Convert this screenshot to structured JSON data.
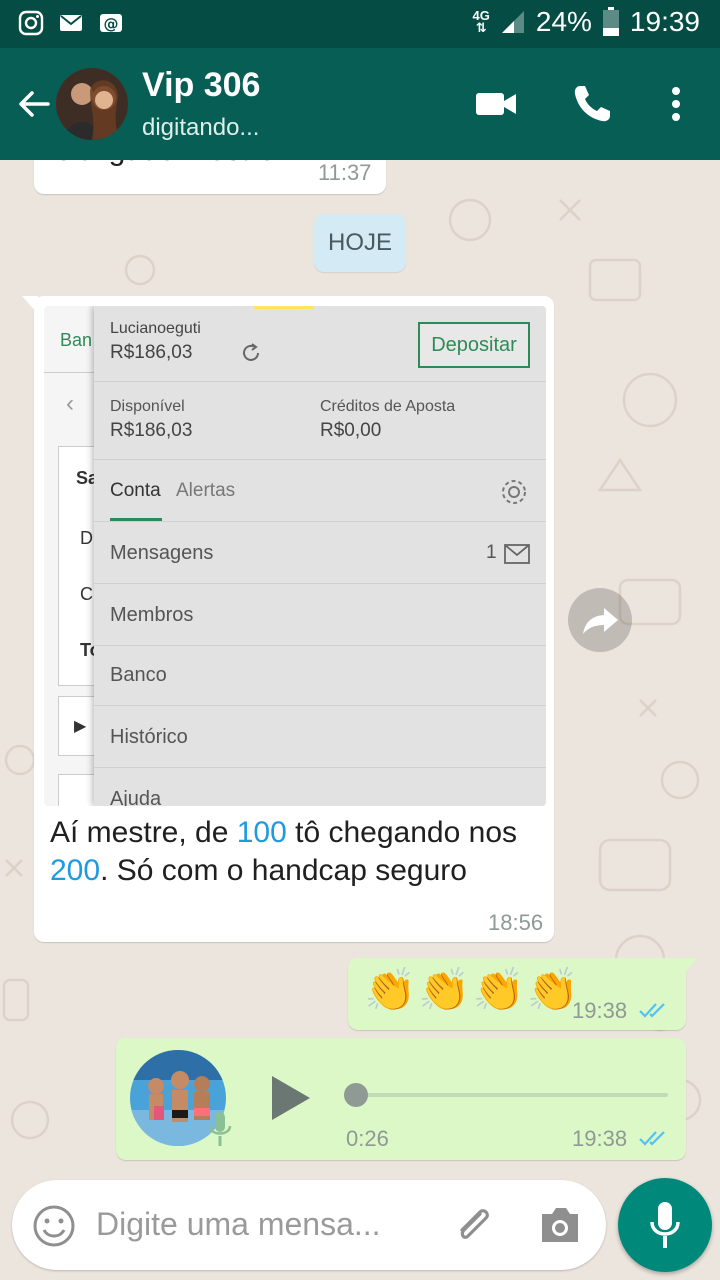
{
  "status_bar": {
    "network": "4G",
    "battery": "24%",
    "clock": "19:39"
  },
  "header": {
    "contact_name": "Vip 306",
    "status": "digitando..."
  },
  "messages": {
    "first_partial": {
      "text": "Obrigado mestre",
      "time": "11:37"
    },
    "date_chip": "HOJE",
    "image_message": {
      "screenshot": {
        "tab_partial": "Ban",
        "username": "Lucianoeguti",
        "balance": "R$186,03",
        "deposit_button": "Depositar",
        "available_label": "Disponível",
        "available_value": "R$186,03",
        "credits_label": "Créditos de Aposta",
        "credits_value": "R$0,00",
        "tabs": [
          "Conta",
          "Alertas"
        ],
        "menu": [
          "Mensagens",
          "Membros",
          "Banco",
          "Histórico",
          "Ajuda"
        ],
        "messages_count": "1",
        "left_col_partial": [
          "Sa",
          "D",
          "C",
          "To"
        ]
      },
      "caption_part1": "Aí mestre, de ",
      "caption_num1": "100",
      "caption_part2": " tô chegando nos ",
      "caption_num2": "200",
      "caption_part3": ". Só com o handcap seguro",
      "time": "18:56"
    },
    "emoji_message": {
      "text": "👏👏👏👏",
      "time": "19:38"
    },
    "voice_message": {
      "duration": "0:26",
      "time": "19:38"
    }
  },
  "input": {
    "placeholder": "Digite uma mensa..."
  },
  "colors": {
    "header": "#075e54",
    "status_bar": "#054d44",
    "outgoing_bubble": "#dcf8c6",
    "fab": "#00897b",
    "number_highlight": "#1e9be0"
  }
}
